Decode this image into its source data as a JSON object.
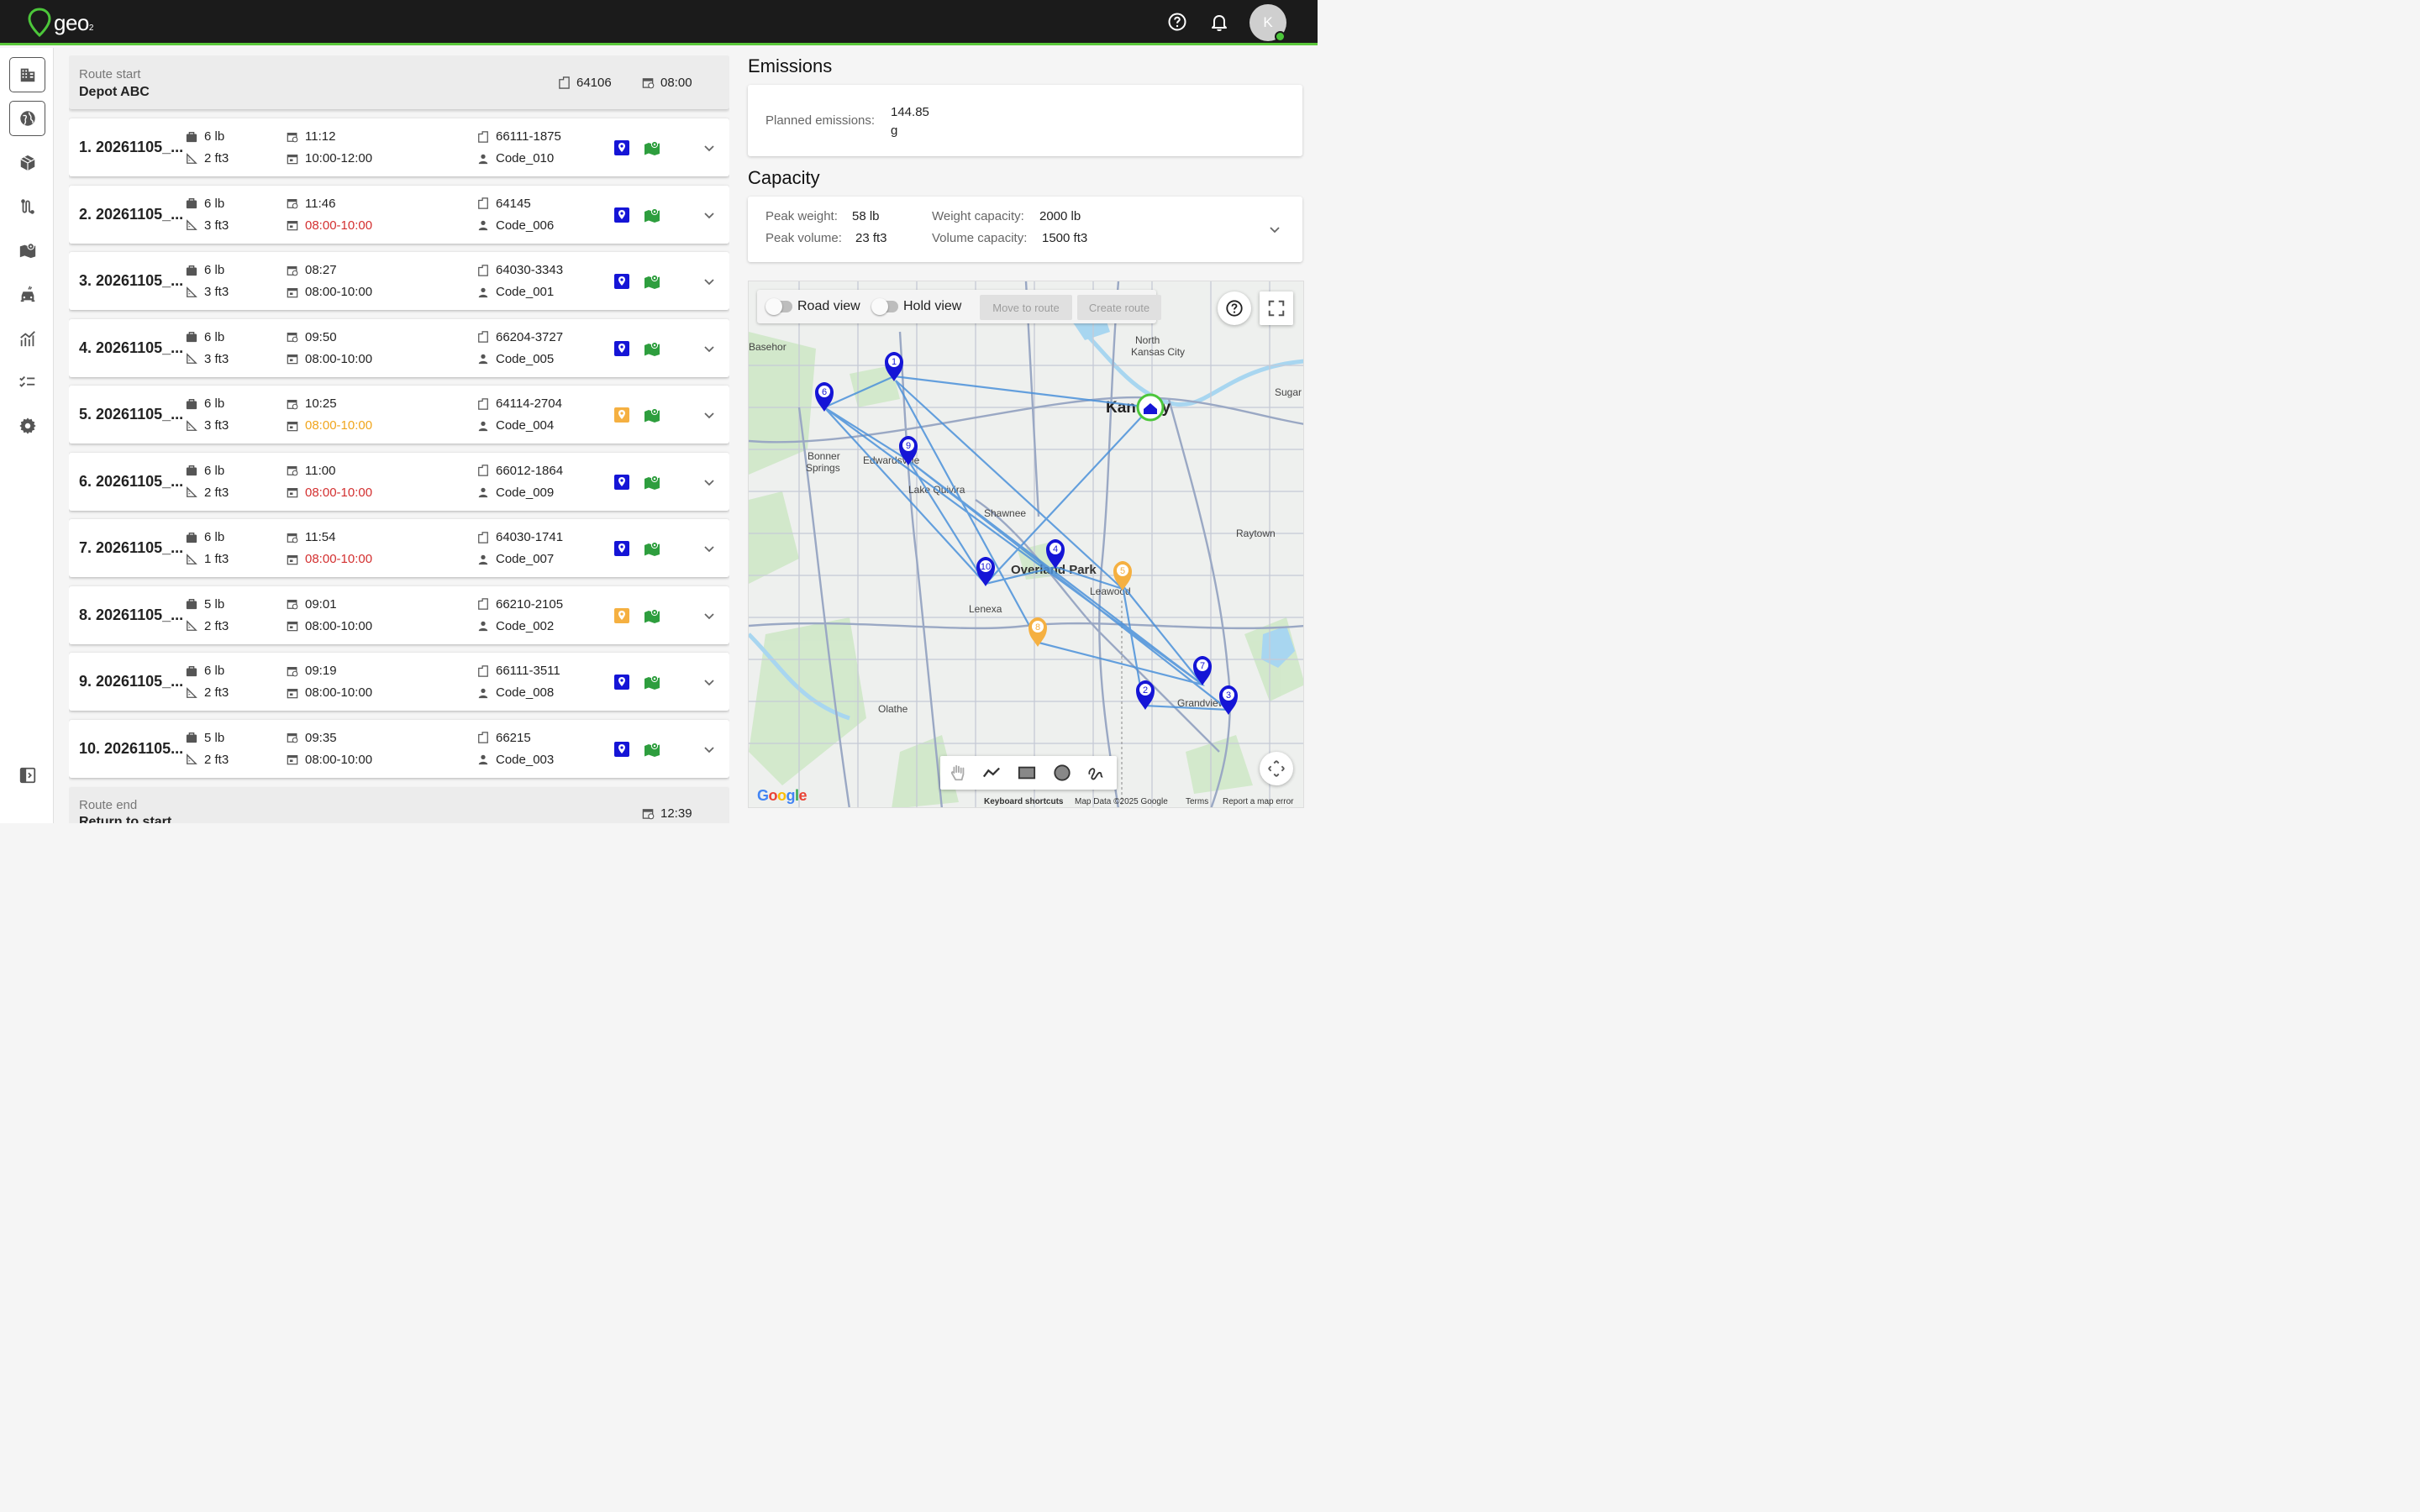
{
  "app": {
    "logo_text": "geo",
    "logo_sub": "2",
    "avatar_initial": "K"
  },
  "colors": {
    "accent": "#5ac83a",
    "route_line": "#4a90d9",
    "pin_blue": "#1515d6",
    "pin_orange": "#f5b041",
    "late": "#d32f2f",
    "warn": "#f0a51b"
  },
  "sidebar": {
    "items": [
      "building-icon",
      "globe-icon",
      "package-icon",
      "route-icon",
      "map-icon",
      "vehicle-icon",
      "analytics-icon",
      "checklist-icon",
      "settings-icon",
      "collapse-sidebar-icon"
    ]
  },
  "route_start": {
    "label": "Route start",
    "name": "Depot ABC",
    "zip": "64106",
    "time": "08:00"
  },
  "stops": [
    {
      "title": "1. 20261105_...",
      "weight": "6 lb",
      "volume": "2 ft3",
      "eta": "11:12",
      "window": "10:00-12:00",
      "window_status": "ok",
      "zip": "66111-1875",
      "code": "Code_010",
      "flag": "blue"
    },
    {
      "title": "2. 20261105_...",
      "weight": "6 lb",
      "volume": "3 ft3",
      "eta": "11:46",
      "window": "08:00-10:00",
      "window_status": "late",
      "zip": "64145",
      "code": "Code_006",
      "flag": "blue"
    },
    {
      "title": "3. 20261105_...",
      "weight": "6 lb",
      "volume": "3 ft3",
      "eta": "08:27",
      "window": "08:00-10:00",
      "window_status": "ok",
      "zip": "64030-3343",
      "code": "Code_001",
      "flag": "blue"
    },
    {
      "title": "4. 20261105_...",
      "weight": "6 lb",
      "volume": "3 ft3",
      "eta": "09:50",
      "window": "08:00-10:00",
      "window_status": "ok",
      "zip": "66204-3727",
      "code": "Code_005",
      "flag": "blue"
    },
    {
      "title": "5. 20261105_...",
      "weight": "6 lb",
      "volume": "3 ft3",
      "eta": "10:25",
      "window": "08:00-10:00",
      "window_status": "warn",
      "zip": "64114-2704",
      "code": "Code_004",
      "flag": "orange"
    },
    {
      "title": "6. 20261105_...",
      "weight": "6 lb",
      "volume": "2 ft3",
      "eta": "11:00",
      "window": "08:00-10:00",
      "window_status": "late",
      "zip": "66012-1864",
      "code": "Code_009",
      "flag": "blue"
    },
    {
      "title": "7. 20261105_...",
      "weight": "6 lb",
      "volume": "1 ft3",
      "eta": "11:54",
      "window": "08:00-10:00",
      "window_status": "late",
      "zip": "64030-1741",
      "code": "Code_007",
      "flag": "blue"
    },
    {
      "title": "8. 20261105_...",
      "weight": "5 lb",
      "volume": "2 ft3",
      "eta": "09:01",
      "window": "08:00-10:00",
      "window_status": "ok",
      "zip": "66210-2105",
      "code": "Code_002",
      "flag": "orange"
    },
    {
      "title": "9. 20261105_...",
      "weight": "6 lb",
      "volume": "2 ft3",
      "eta": "09:19",
      "window": "08:00-10:00",
      "window_status": "ok",
      "zip": "66111-3511",
      "code": "Code_008",
      "flag": "blue"
    },
    {
      "title": "10. 20261105...",
      "weight": "5 lb",
      "volume": "2 ft3",
      "eta": "09:35",
      "window": "08:00-10:00",
      "window_status": "ok",
      "zip": "66215",
      "code": "Code_003",
      "flag": "blue"
    }
  ],
  "route_end": {
    "label": "Route end",
    "name": "Return to start",
    "time": "12:39"
  },
  "emissions": {
    "title": "Emissions",
    "label": "Planned emissions:",
    "value": "144.85",
    "unit": "g"
  },
  "capacity": {
    "title": "Capacity",
    "peak_weight_label": "Peak weight:",
    "peak_weight": "58 lb",
    "peak_volume_label": "Peak volume:",
    "peak_volume": "23 ft3",
    "weight_capacity_label": "Weight capacity:",
    "weight_capacity": "2000 lb",
    "volume_capacity_label": "Volume capacity:",
    "volume_capacity": "1500 ft3"
  },
  "map": {
    "road_view": "Road view",
    "hold_view": "Hold view",
    "move_to_route": "Move to route",
    "create_route": "Create route",
    "places": [
      "North Kansas City",
      "Kansas City",
      "Basehor",
      "Bonner Springs",
      "Edwardsville",
      "Lake Quivira",
      "Shawnee",
      "Overland Park",
      "Leawood",
      "Lenexa",
      "Olathe",
      "Grandview",
      "Raytown",
      "Sugar Creek"
    ],
    "attribution": {
      "google": "Google",
      "shortcuts": "Keyboard shortcuts",
      "data": "Map Data ©2025 Google",
      "terms": "Terms",
      "report": "Report a map error"
    }
  }
}
